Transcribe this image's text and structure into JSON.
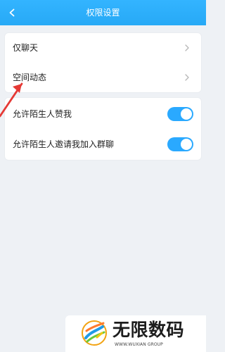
{
  "header": {
    "title": "权限设置",
    "back_icon": "chevron-left-icon"
  },
  "settings": {
    "group1": [
      {
        "label": "仅聊天",
        "icon": "chevron-right-icon"
      },
      {
        "label": "空间动态",
        "icon": "chevron-right-icon"
      }
    ],
    "group2": [
      {
        "label": "允许陌生人赞我",
        "enabled": true
      },
      {
        "label": "允许陌生人邀请我加入群聊",
        "enabled": true
      }
    ]
  },
  "watermark": {
    "brand": "无限数码",
    "url": "WWW.WUXIAN GROUP"
  },
  "colors": {
    "header_gradient_top": "#33b4ff",
    "header_gradient_bottom": "#27a9f6",
    "switch_on": "#2aa9ff",
    "annotation_arrow": "#e53935",
    "background": "#eef1f5"
  }
}
